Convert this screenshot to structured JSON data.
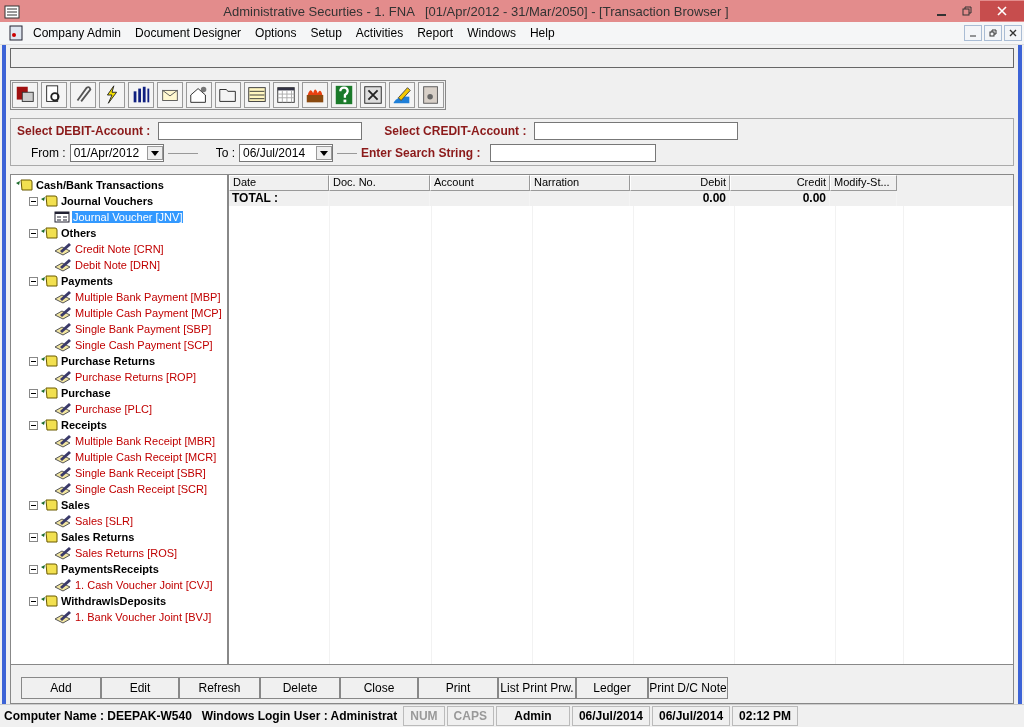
{
  "window": {
    "title": "Administrative Securties - 1. FNA   [01/Apr/2012 - 31/Mar/2050] - [Transaction Browser ]"
  },
  "menu": [
    "Company Admin",
    "Document Designer",
    "Options",
    "Setup",
    "Activities",
    "Report",
    "Windows",
    "Help"
  ],
  "filters": {
    "debit_label": "Select DEBIT-Account :",
    "credit_label": "Select CREDIT-Account :",
    "from_label": "From :",
    "from_value": "01/Apr/2012",
    "to_label": "To :",
    "to_value": "06/Jul/2014",
    "search_label": "Enter Search String :"
  },
  "tree": {
    "label": "Cash/Bank Transactions",
    "children": [
      {
        "label": "Journal Vouchers",
        "expanded": true,
        "children": [
          {
            "label": "Journal Voucher [JNV]",
            "kind": "form",
            "selected": true
          }
        ]
      },
      {
        "label": "Others",
        "expanded": true,
        "children": [
          {
            "label": "Credit Note [CRN]",
            "kind": "voucher",
            "selected": false
          },
          {
            "label": "Debit Note [DRN]",
            "kind": "voucher",
            "selected": false
          }
        ]
      },
      {
        "label": "Payments",
        "expanded": true,
        "children": [
          {
            "label": "Multiple Bank Payment [MBP]",
            "kind": "voucher",
            "selected": false
          },
          {
            "label": "Multiple Cash Payment [MCP]",
            "kind": "voucher",
            "selected": false
          },
          {
            "label": "Single Bank Payment [SBP]",
            "kind": "voucher",
            "selected": false
          },
          {
            "label": "Single Cash Payment [SCP]",
            "kind": "voucher",
            "selected": false
          }
        ]
      },
      {
        "label": "Purchase Returns",
        "expanded": true,
        "children": [
          {
            "label": "Purchase Returns [ROP]",
            "kind": "voucher",
            "selected": false
          }
        ]
      },
      {
        "label": "Purchase",
        "expanded": true,
        "children": [
          {
            "label": "Purchase [PLC]",
            "kind": "voucher",
            "selected": false
          }
        ]
      },
      {
        "label": "Receipts",
        "expanded": true,
        "children": [
          {
            "label": "Multiple Bank Receipt [MBR]",
            "kind": "voucher",
            "selected": false
          },
          {
            "label": "Multiple Cash Receipt [MCR]",
            "kind": "voucher",
            "selected": false
          },
          {
            "label": "Single Bank Receipt [SBR]",
            "kind": "voucher",
            "selected": false
          },
          {
            "label": "Single Cash Receipt [SCR]",
            "kind": "voucher",
            "selected": false
          }
        ]
      },
      {
        "label": "Sales",
        "expanded": true,
        "children": [
          {
            "label": "Sales [SLR]",
            "kind": "voucher",
            "selected": false
          }
        ]
      },
      {
        "label": "Sales Returns",
        "expanded": true,
        "children": [
          {
            "label": "Sales Returns [ROS]",
            "kind": "voucher",
            "selected": false
          }
        ]
      },
      {
        "label": "PaymentsReceipts",
        "expanded": true,
        "children": [
          {
            "label": "1. Cash Voucher Joint [CVJ]",
            "kind": "voucher",
            "selected": false
          }
        ]
      },
      {
        "label": "WithdrawlsDeposits",
        "expanded": true,
        "children": [
          {
            "label": "1. Bank Voucher Joint [BVJ]",
            "kind": "voucher",
            "selected": false
          }
        ]
      }
    ]
  },
  "table": {
    "columns": [
      "Date",
      "Doc. No.",
      "Account",
      "Narration",
      "Debit",
      "Credit",
      "Modify-St..."
    ],
    "total_row": {
      "label": "TOTAL :",
      "debit": "0.00",
      "credit": "0.00"
    }
  },
  "buttons": [
    "Add",
    "Edit",
    "Refresh",
    "Delete",
    "Close",
    "Print",
    "List Print Prw.",
    "Ledger",
    "Print D/C Note"
  ],
  "status_bar": [
    {
      "text": "Computer Name : DEEPAK-W540",
      "kind": "text"
    },
    {
      "text": "Windows Login User : Administrat",
      "kind": "text"
    },
    {
      "text": "NUM",
      "kind": "key",
      "on": false
    },
    {
      "text": "CAPS",
      "kind": "key",
      "on": false
    },
    {
      "text": "Admin",
      "kind": "panel"
    },
    {
      "text": "06/Jul/2014",
      "kind": "panel"
    },
    {
      "text": "06/Jul/2014",
      "kind": "panel"
    },
    {
      "text": "02:12 PM",
      "kind": "panel"
    }
  ]
}
